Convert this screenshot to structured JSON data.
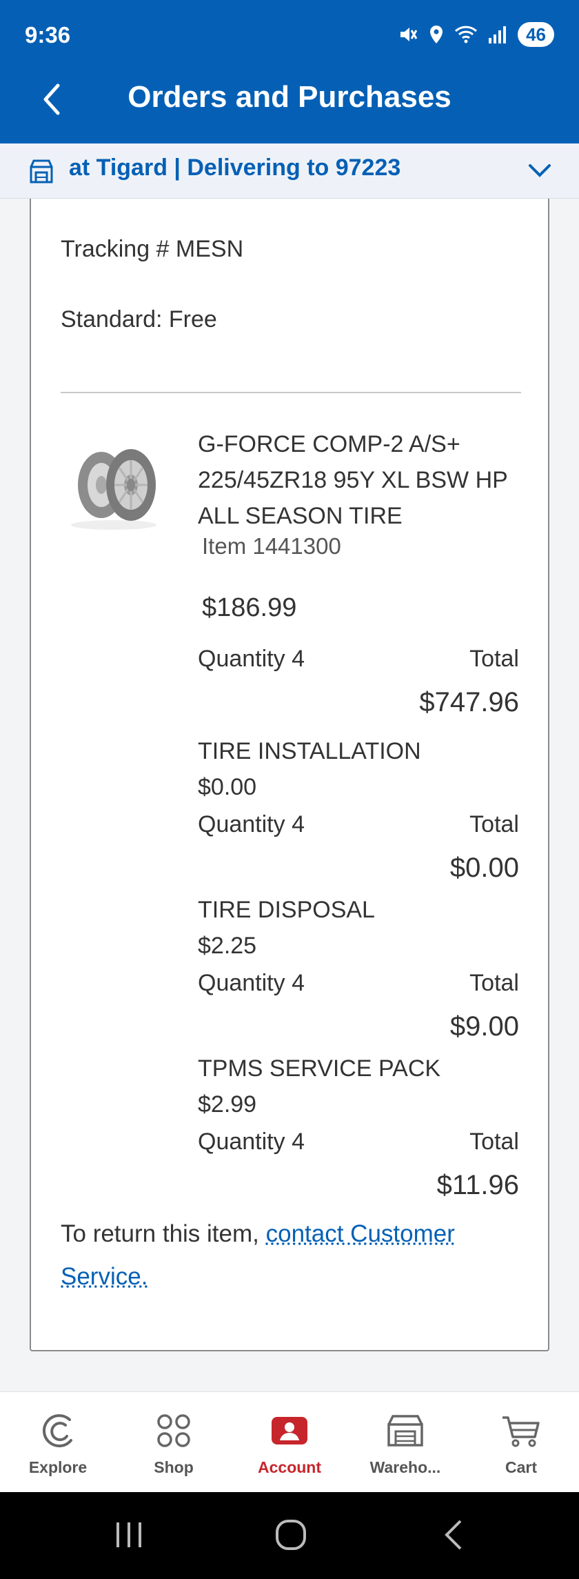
{
  "status_bar": {
    "time": "9:36",
    "battery": "46",
    "icons": [
      "mute-icon",
      "location-icon",
      "wifi-icon",
      "signal-icon"
    ]
  },
  "header": {
    "title": "Orders and Purchases",
    "background_color": "#0560b5"
  },
  "location_bar": {
    "text": "at Tigard | Delivering to 97223"
  },
  "order": {
    "tracking": "Tracking # MESN",
    "shipping": "Standard: Free",
    "product": {
      "name": "G-FORCE COMP-2 A/S+ 225/45ZR18 95Y XL BSW HP ALL SEASON TIRE",
      "item_number": "Item 1441300",
      "price": "$186.99",
      "quantity": "Quantity 4",
      "total_label": "Total",
      "total": "$747.96"
    },
    "services": [
      {
        "name": "TIRE INSTALLATION",
        "price": "$0.00",
        "quantity": "Quantity 4",
        "total_label": "Total",
        "total": "$0.00"
      },
      {
        "name": "TIRE DISPOSAL",
        "price": "$2.25",
        "quantity": "Quantity 4",
        "total_label": "Total",
        "total": "$9.00"
      },
      {
        "name": "TPMS SERVICE PACK",
        "price": "$2.99",
        "quantity": "Quantity 4",
        "total_label": "Total",
        "total": "$11.96"
      }
    ],
    "return_prefix": "To return this item, ",
    "return_link": "contact Customer Service."
  },
  "bottom_nav": {
    "items": [
      {
        "label": "Explore",
        "icon": "explore-icon"
      },
      {
        "label": "Shop",
        "icon": "shop-icon"
      },
      {
        "label": "Account",
        "icon": "account-icon",
        "active": true
      },
      {
        "label": "Wareho...",
        "icon": "warehouse-icon"
      },
      {
        "label": "Cart",
        "icon": "cart-icon"
      }
    ],
    "active_color": "#c7252c"
  }
}
